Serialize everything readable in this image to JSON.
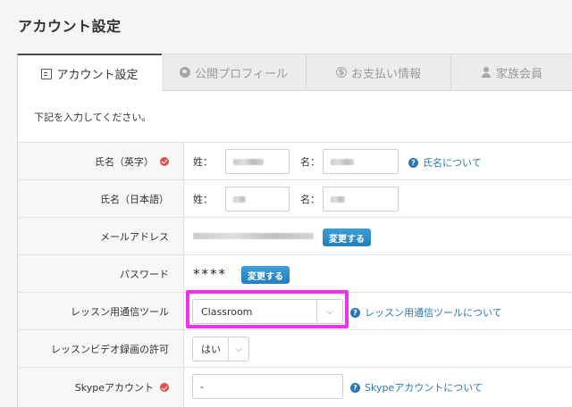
{
  "page": {
    "title": "アカウント設定"
  },
  "tabs": [
    {
      "label": "アカウント設定",
      "icon": "document-icon",
      "active": true
    },
    {
      "label": "公開プロフィール",
      "icon": "globe-icon",
      "active": false
    },
    {
      "label": "お支払い情報",
      "icon": "coin-icon",
      "active": false
    },
    {
      "label": "家族会員",
      "icon": "people-icon",
      "active": false
    }
  ],
  "form": {
    "intro": "下記を入力してください。",
    "name_en": {
      "label": "氏名（英字）",
      "last_prefix": "姓：",
      "first_prefix": "名：",
      "help": "氏名について"
    },
    "name_ja": {
      "label": "氏名（日本語）",
      "last_prefix": "姓：",
      "first_prefix": "名："
    },
    "email": {
      "label": "メールアドレス",
      "change_button": "変更する"
    },
    "password": {
      "label": "パスワード",
      "masked": "****",
      "change_button": "変更する"
    },
    "lesson_tool": {
      "label": "レッスン用通信ツール",
      "value": "Classroom",
      "help": "レッスン用通信ツールについて"
    },
    "video_permission": {
      "label": "レッスンビデオ録画の許可",
      "value": "はい"
    },
    "skype": {
      "label": "Skypeアカウント",
      "value": "-",
      "help": "Skypeアカウントについて"
    }
  },
  "colors": {
    "link": "#2a77b8",
    "button": "#237fbd",
    "highlight": "#f231f0",
    "required": "#d9534f"
  }
}
